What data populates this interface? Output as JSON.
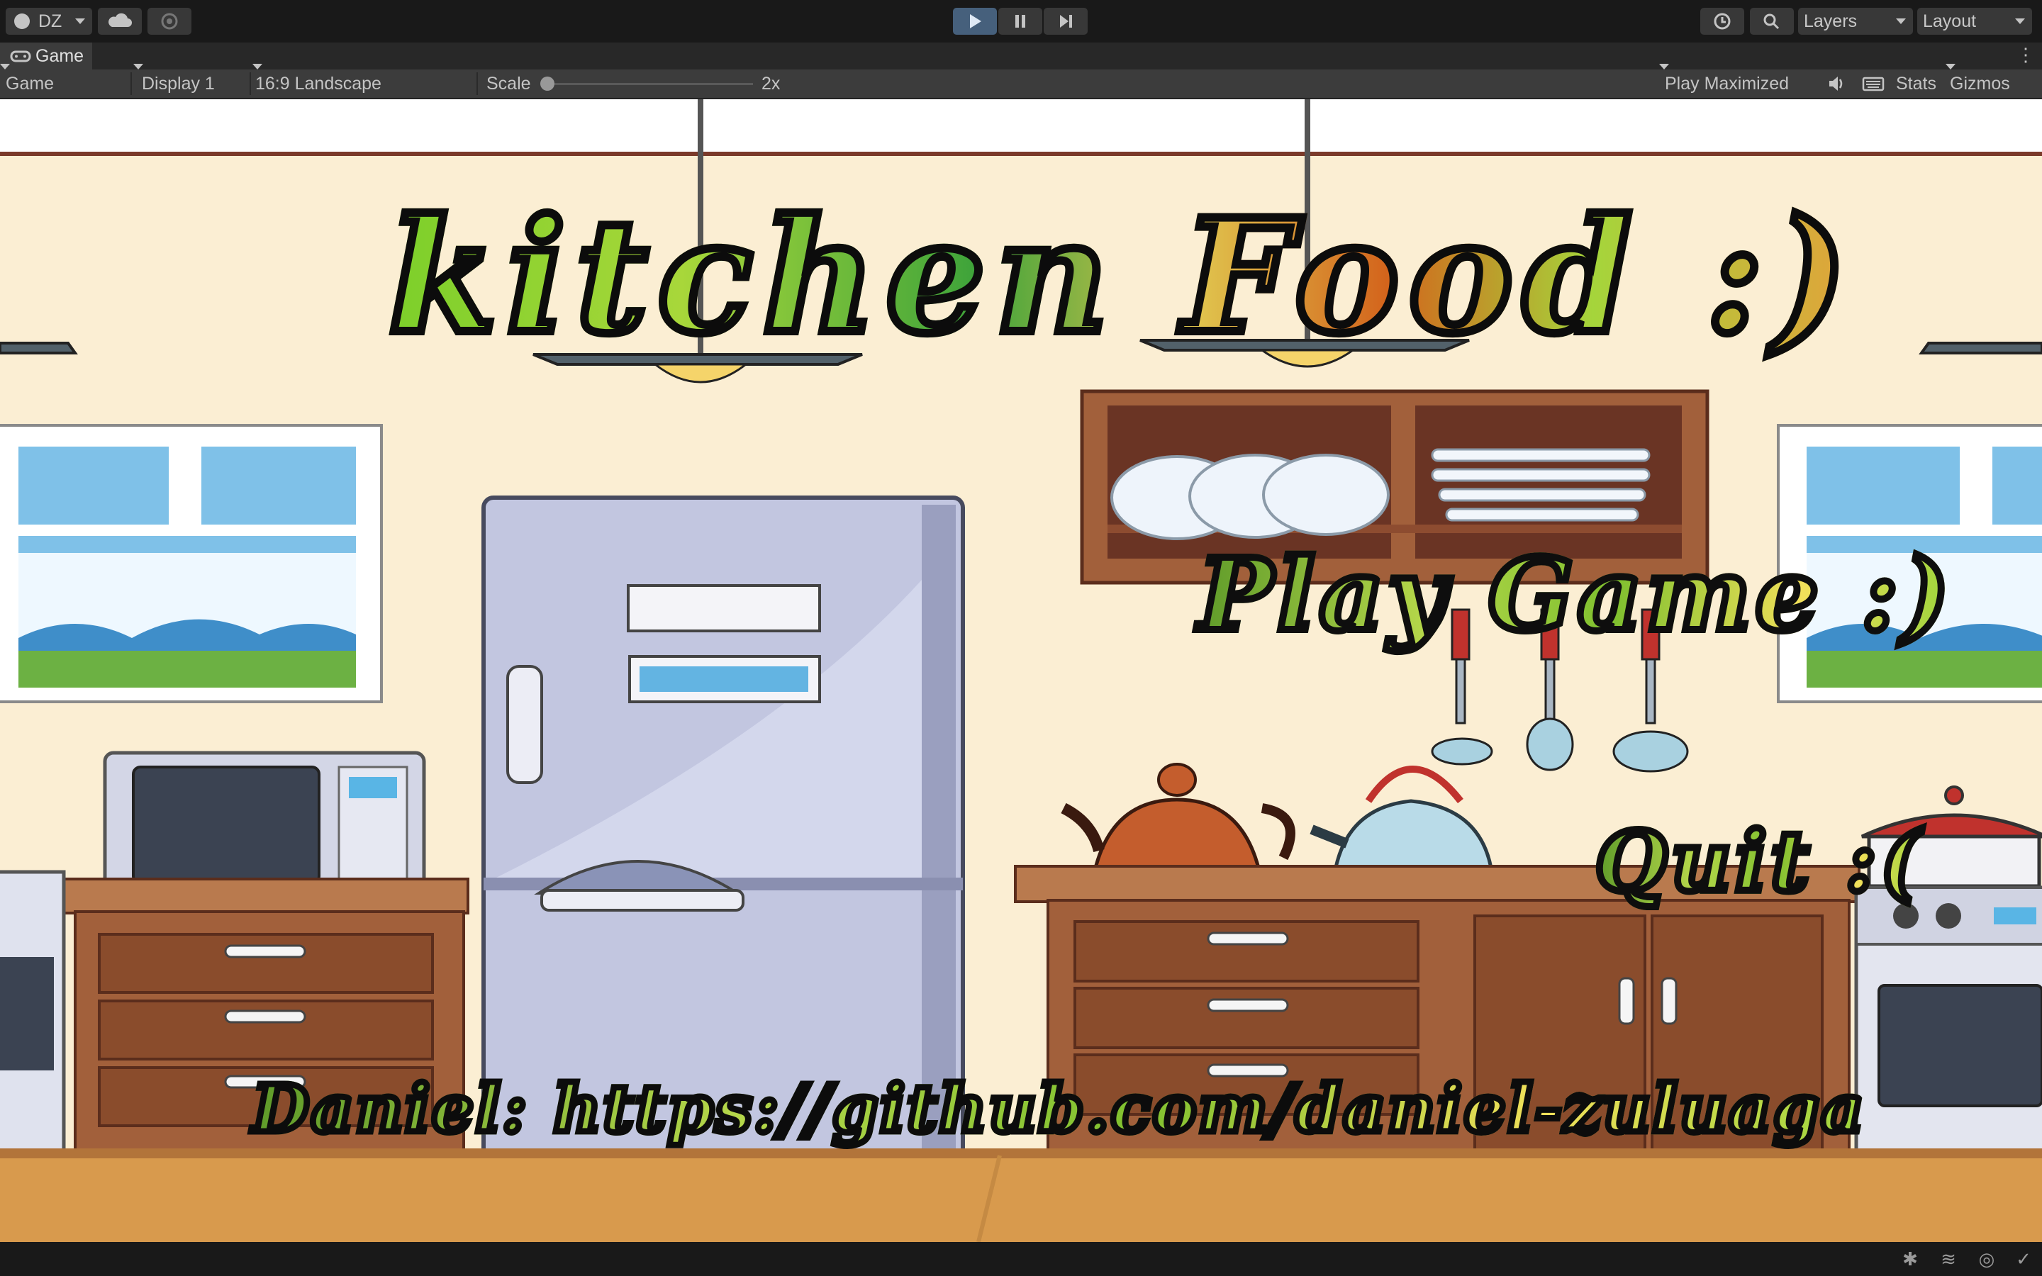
{
  "toolbar": {
    "account_label": "DZ",
    "layers_label": "Layers",
    "layout_label": "Layout",
    "icons": [
      "account-icon",
      "cloud-icon",
      "collab-icon",
      "play-icon",
      "pause-icon",
      "step-icon",
      "history-icon",
      "search-icon"
    ],
    "play_active_color": "#46607c"
  },
  "tab": {
    "title": "Game"
  },
  "game_view_bar": {
    "mode": "Game",
    "display": "Display 1",
    "aspect": "16:9 Landscape",
    "scale_label": "Scale",
    "scale_value": "2x",
    "scale_level": 0.0,
    "play_mode": "Play Maximized",
    "stats_label": "Stats",
    "gizmos_label": "Gizmos"
  },
  "game": {
    "title": "kitchen Food :)",
    "play_button": "Play Game :)",
    "quit_button": "Quit :(",
    "credit": "Daniel: https://github.com/daniel-zuluaga"
  },
  "colors": {
    "wall": "#fbeed3",
    "floor": "#d89a4d",
    "cabinet": "#a2603b",
    "text_green": "#7fc02f"
  }
}
